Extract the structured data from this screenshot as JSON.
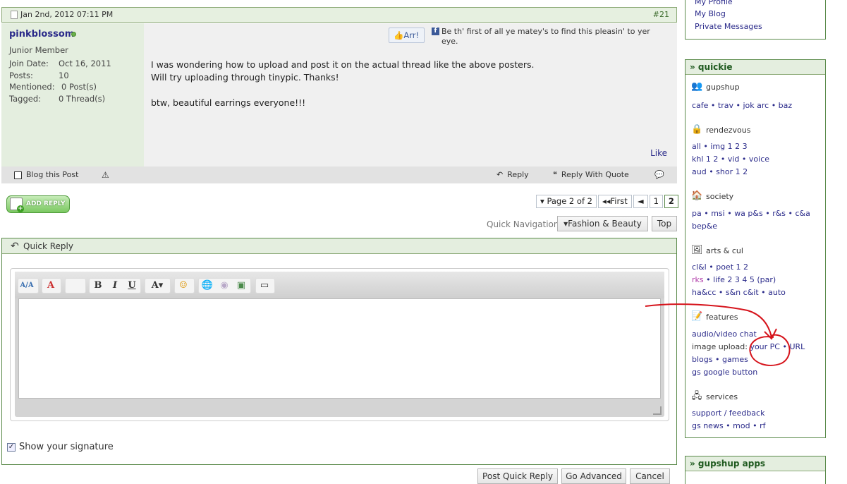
{
  "post": {
    "date": "Jan 2nd, 2012 07:11 PM",
    "number": "#21",
    "username": "pinkblossom",
    "user_title": "Junior Member",
    "stats": [
      {
        "k": "Join Date:",
        "v": "Oct 16, 2011"
      },
      {
        "k": "Posts:",
        "v": "10"
      },
      {
        "k": "Mentioned:",
        "v": "0 Post(s)"
      },
      {
        "k": "Tagged:",
        "v": "0 Thread(s)"
      }
    ],
    "arr_label": "Arr!",
    "fb_icon": "f",
    "fb_text": "Be th' first of all ye matey's to find this pleasin' to yer eye.",
    "message_lines": [
      "I was wondering how to upload and post it on the actual thread like the above posters.",
      "Will try uploading through tinypic. Thanks!",
      "btw, beautiful earrings everyone!!!"
    ],
    "like": "Like",
    "blog_this": "Blog this Post",
    "warn_icon": "⚠",
    "reply": "Reply",
    "reply_quote": "Reply With Quote"
  },
  "actions": {
    "add_reply": "ADD REPLY",
    "pager": {
      "label": "Page 2 of 2",
      "first": "First",
      "prev": "◄",
      "p1": "1",
      "p2": "2"
    },
    "quick_nav": "Quick Navigation",
    "forum": "Fashion & Beauty",
    "top": "Top"
  },
  "quick_reply": {
    "title": "Quick Reply",
    "show_signature": "Show your signature",
    "buttons": {
      "post": "Post Quick Reply",
      "advanced": "Go Advanced",
      "cancel": "Cancel"
    },
    "toolbar": {
      "bold": "B",
      "italic": "I",
      "underline": "U",
      "font": "A"
    }
  },
  "sidebar": {
    "top_links": [
      "My Profile",
      "My Blog",
      "Private Messages"
    ],
    "quickie_title": "» quickie",
    "apps_title": "» gupshup apps",
    "sections": {
      "gupshup": {
        "title": "gupshup",
        "line1": "cafe • trav • jok arc • baz"
      },
      "rendezvous": {
        "title": "rendezvous",
        "line1": "all • img 1 2 3",
        "line2": "khl 1 2 • vid • voice",
        "line3": "aud • shor 1 2"
      },
      "society": {
        "title": "society",
        "line1": "pa • msi • wa p&s • r&s • c&a",
        "line2": "bep&e"
      },
      "arts": {
        "title": "arts & cul",
        "line1": "cl&l • poet 1 2",
        "rks": "rks",
        "line2": " • life 2 3 4 5 (par)",
        "line3": "ha&cc • s&n c&it • auto"
      },
      "features": {
        "title": "features",
        "line1": "audio/video chat",
        "upload_label": "image upload:",
        "your_pc": "your PC",
        "sep": " • ",
        "url": "URL",
        "line3": "blogs • games",
        "line4": "gs google button"
      },
      "services": {
        "title": "services",
        "line1": "support / feedback",
        "line2": "gs news • mod • rf"
      }
    }
  },
  "colors": {
    "accent_green": "#5a8a4a",
    "link": "#2a2a8a",
    "annotation": "#d6141c"
  }
}
